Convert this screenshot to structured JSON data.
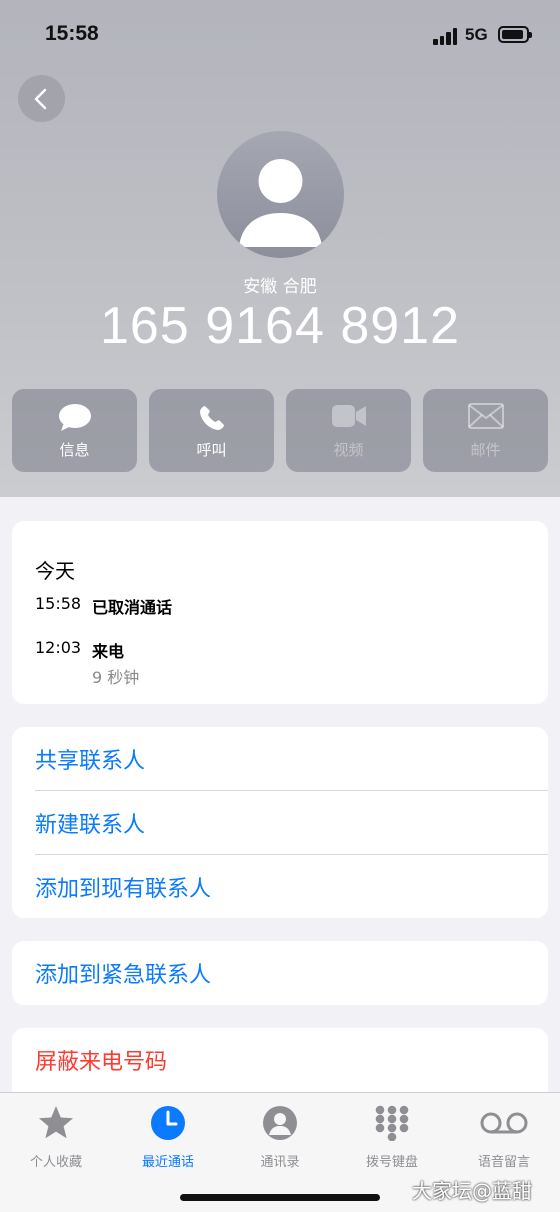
{
  "status_bar": {
    "time": "15:58",
    "network": "5G"
  },
  "contact": {
    "location": "安徽 合肥",
    "number": "165 9164 8912"
  },
  "actions": [
    {
      "label": "信息",
      "icon": "message-icon",
      "enabled": true
    },
    {
      "label": "呼叫",
      "icon": "phone-icon",
      "enabled": true
    },
    {
      "label": "视频",
      "icon": "video-icon",
      "enabled": false
    },
    {
      "label": "邮件",
      "icon": "mail-icon",
      "enabled": false
    }
  ],
  "calls": {
    "title": "今天",
    "items": [
      {
        "time": "15:58",
        "type": "已取消通话",
        "duration": ""
      },
      {
        "time": "12:03",
        "type": "来电",
        "duration": "9 秒钟"
      }
    ]
  },
  "contact_actions": [
    "共享联系人",
    "新建联系人",
    "添加到现有联系人"
  ],
  "emergency_action": "添加到紧急联系人",
  "block_action": "屏蔽来电号码",
  "colors": {
    "accent": "#0a7aff",
    "danger": "#fe3b30"
  },
  "tabs": [
    {
      "label": "个人收藏",
      "icon": "star-icon",
      "active": false
    },
    {
      "label": "最近通话",
      "icon": "clock-icon",
      "active": true
    },
    {
      "label": "通讯录",
      "icon": "person-icon",
      "active": false
    },
    {
      "label": "拨号键盘",
      "icon": "keypad-icon",
      "active": false
    },
    {
      "label": "语音留言",
      "icon": "voicemail-icon",
      "active": false
    }
  ],
  "watermark": "大家坛@蓝甜"
}
